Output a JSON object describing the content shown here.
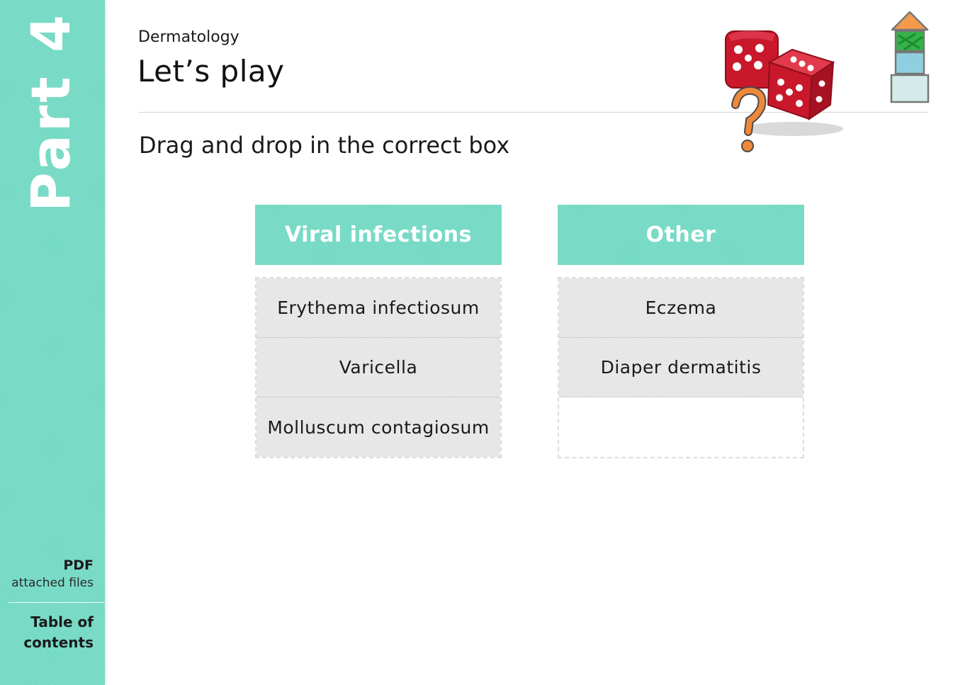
{
  "sidebar": {
    "part_label": "Part 4",
    "pdf_title": "PDF",
    "pdf_subtitle": "attached files",
    "toc_label": "Table of contents"
  },
  "header": {
    "subject": "Dermatology",
    "title": "Let’s play"
  },
  "instruction": "Drag and drop in the correct box",
  "columns": [
    {
      "title": "Viral infections",
      "items": [
        "Erythema infectiosum",
        "Varicella",
        "Molluscum contagiosum"
      ]
    },
    {
      "title": "Other",
      "items": [
        "Eczema",
        "Diaper dermatitis",
        ""
      ]
    }
  ],
  "colors": {
    "accent": "#6fd8c2",
    "item_background": "#e4e4e4",
    "dice_red": "#c9182b",
    "question_mark": "#f0883a"
  },
  "icons": {
    "illustration": "dice-question-mark",
    "navigation": "stacked-blocks-home-icon"
  }
}
